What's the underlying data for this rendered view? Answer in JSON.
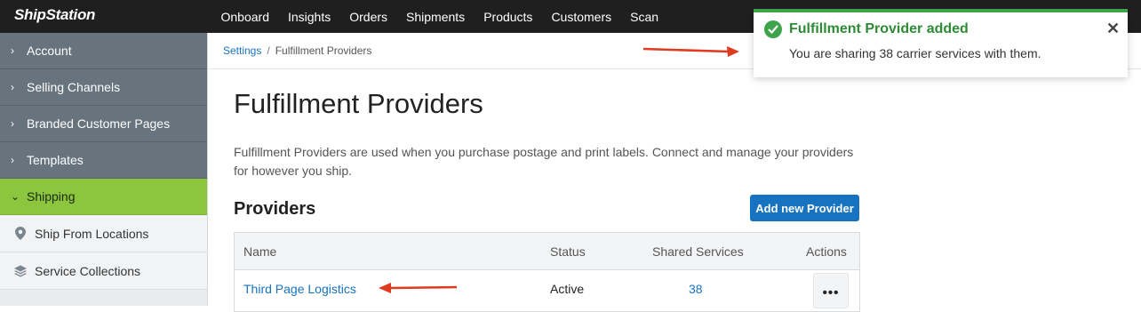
{
  "app": {
    "logo": "ShipStation"
  },
  "topnav": {
    "items": [
      "Onboard",
      "Insights",
      "Orders",
      "Shipments",
      "Products",
      "Customers",
      "Scan"
    ]
  },
  "sidebar": {
    "items": [
      {
        "label": "Account",
        "chevron": "›"
      },
      {
        "label": "Selling Channels",
        "chevron": "›"
      },
      {
        "label": "Branded Customer Pages",
        "chevron": "›"
      },
      {
        "label": "Templates",
        "chevron": "›"
      },
      {
        "label": "Shipping",
        "chevron": "⌄"
      }
    ],
    "subitems": [
      {
        "label": "Ship From Locations",
        "icon": "map-pin-icon"
      },
      {
        "label": "Service Collections",
        "icon": "layers-icon"
      }
    ]
  },
  "breadcrumb": {
    "parent": "Settings",
    "separator": "/",
    "current": "Fulfillment Providers"
  },
  "page": {
    "title": "Fulfillment Providers",
    "description": "Fulfillment Providers are used when you purchase postage and print labels. Connect and manage your providers for however you ship.",
    "section_title": "Providers",
    "add_button": "Add new Provider"
  },
  "table": {
    "columns": [
      "Name",
      "Status",
      "Shared Services",
      "Actions"
    ],
    "rows": [
      {
        "name": "Third Page Logistics",
        "status": "Active",
        "shared_services": "38",
        "actions": "•••"
      }
    ]
  },
  "toast": {
    "title": "Fulfillment Provider added",
    "message": "You are sharing 38 carrier services with them.",
    "close": "✕"
  },
  "colors": {
    "accent_green": "#8cc63f",
    "link_blue": "#1773c0",
    "success_green": "#3ea34a",
    "annotation_red": "#e03a1f"
  }
}
